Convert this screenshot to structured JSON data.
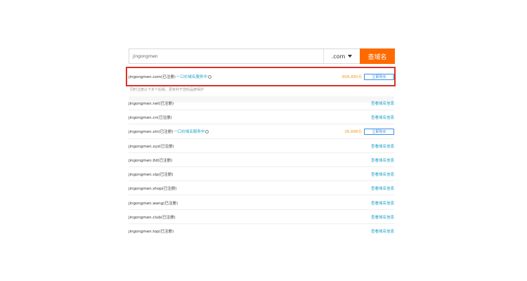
{
  "search": {
    "query": "jingongmen",
    "tld": ".com",
    "button_label": "查域名"
  },
  "top_result": {
    "domain": "jingongmen.com(已注册)",
    "promo": "一口价域名服务中",
    "price": "808,880元",
    "buy_label": "立即购买"
  },
  "hint": "同时注册以下多个后缀，更有利于您的品牌保护",
  "results": [
    {
      "domain": "jingongmen.net(已注册)",
      "action": "查看域名信息"
    },
    {
      "domain": "jingongmen.cn(已注册)",
      "action": "查看域名信息"
    },
    {
      "domain": "jingongmen.xin(已注册)",
      "promo": "一口价域名服务中",
      "price": "38,888元",
      "buy_label": "立即购买"
    },
    {
      "domain": "jingongmen.xyz(已注册)",
      "action": "查看域名信息"
    },
    {
      "domain": "jingongmen.ltd(已注册)",
      "action": "查看域名信息"
    },
    {
      "domain": "jingongmen.vip(已注册)",
      "action": "查看域名信息"
    },
    {
      "domain": "jingongmen.shop(已注册)",
      "action": "查看域名信息"
    },
    {
      "domain": "jingongmen.wang(已注册)",
      "action": "查看域名信息"
    },
    {
      "domain": "jingongmen.club(已注册)",
      "action": "查看域名信息"
    },
    {
      "domain": "jingongmen.top(已注册)",
      "action": "查看域名信息"
    }
  ],
  "colors": {
    "accent": "#ff6a00",
    "highlight_border": "#d9322b",
    "link": "#1aa1c4",
    "price": "#f29b2a",
    "buy_border": "#3a8ee6"
  },
  "icons": {
    "promo_info": "info-icon",
    "dropdown": "chevron-down-icon"
  }
}
